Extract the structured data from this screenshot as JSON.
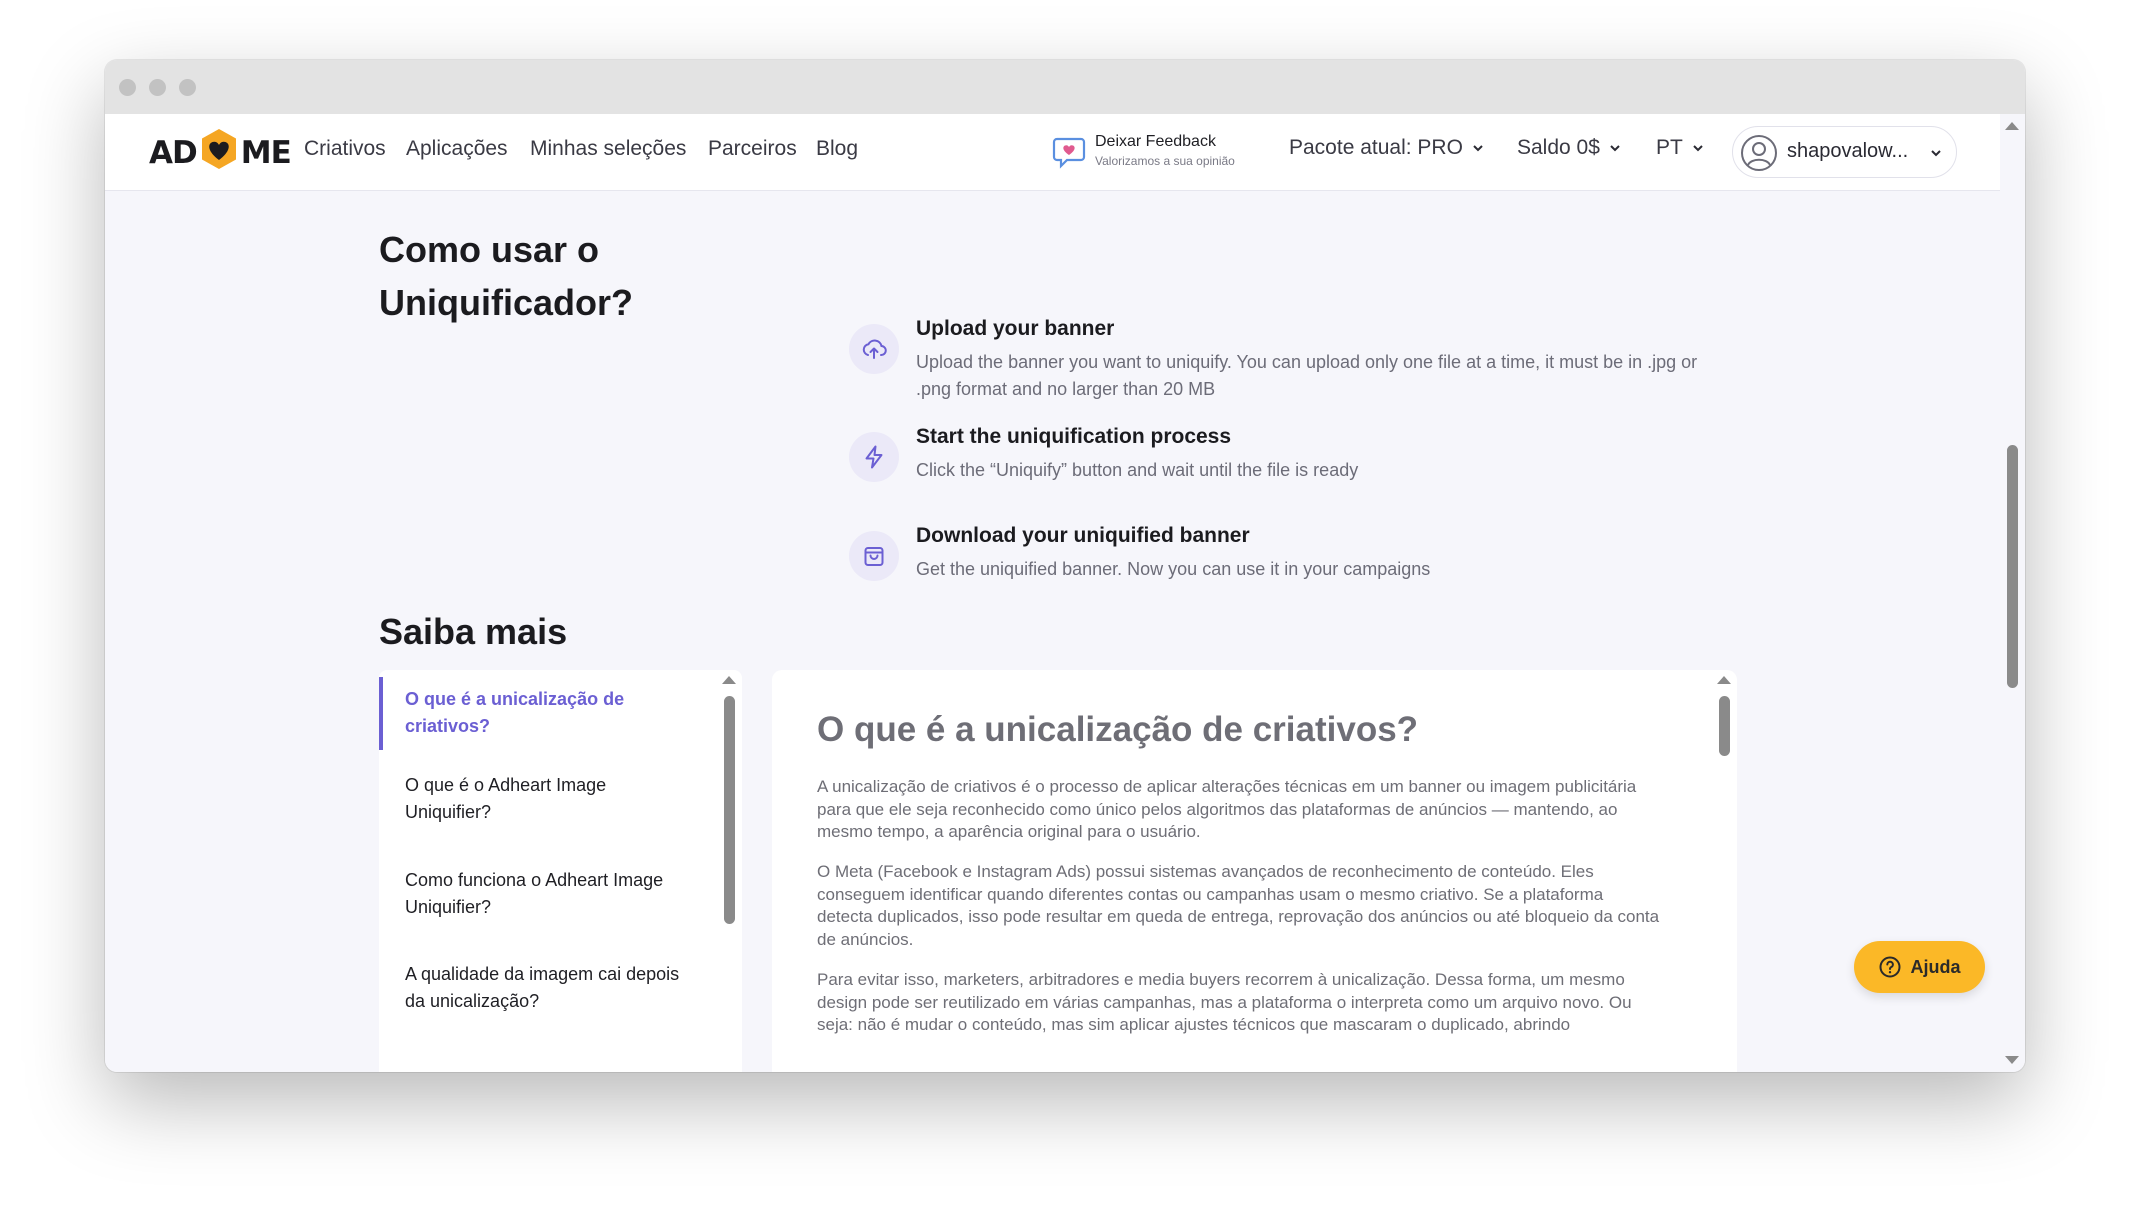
{
  "nav": {
    "logo_left": "AD",
    "logo_right": "ME",
    "links": [
      "Criativos",
      "Aplicações",
      "Minhas seleções",
      "Parceiros",
      "Blog"
    ],
    "feedback_title": "Deixar Feedback",
    "feedback_subtitle": "Valorizamos a sua opinião",
    "package_label": "Pacote atual: PRO",
    "balance_label": "Saldo 0$",
    "language_label": "PT",
    "user_name": "shapovalow..."
  },
  "how_to": {
    "title": "Como usar o Uniquificador?",
    "steps": [
      {
        "icon": "cloud-upload-icon",
        "title": "Upload your banner",
        "description": "Upload the banner you want to uniquify. You can upload only one file at a time, it must be in .jpg or .png format and no larger than 20 MB"
      },
      {
        "icon": "lightning-icon",
        "title": "Start the uniquification process",
        "description": "Click the “Uniquify” button and wait until the file is ready"
      },
      {
        "icon": "shopping-bag-icon",
        "title": "Download your uniquified banner",
        "description": "Get the uniquified banner. Now you can use it in your campaigns"
      }
    ]
  },
  "learn_more": {
    "title": "Saiba mais",
    "faq": [
      "O que é a unicalização de criativos?",
      "O que é o Adheart Image Uniquifier?",
      "Como funciona o Adheart Image Uniquifier?",
      "A qualidade da imagem cai depois da unicalização?"
    ],
    "active_index": 0,
    "article": {
      "title": "O que é a unicalização de criativos?",
      "paragraphs": [
        "A unicalização de criativos é o processo de aplicar alterações técnicas em um banner ou imagem publicitária para que ele seja reconhecido como único pelos algoritmos das plataformas de anúncios — mantendo, ao mesmo tempo, a aparência original para o usuário.",
        "O Meta (Facebook e Instagram Ads) possui sistemas avançados de reconhecimento de conteúdo. Eles conseguem identificar quando diferentes contas ou campanhas usam o mesmo criativo. Se a plataforma detecta duplicados, isso pode resultar em queda de entrega, reprovação dos anúncios ou até bloqueio da conta de anúncios.",
        "Para evitar isso, marketers, arbitradores e media buyers recorrem à unicalização. Dessa forma, um mesmo design pode ser reutilizado em várias campanhas, mas a plataforma o interpreta como um arquivo novo. Ou seja: não é mudar o conteúdo, mas sim aplicar ajustes técnicos que mascaram o duplicado, abrindo"
      ]
    }
  },
  "help_button": "Ajuda",
  "colors": {
    "accent": "#6b5fd3",
    "help": "#fbb827",
    "logo_hex": "#f5a623"
  }
}
